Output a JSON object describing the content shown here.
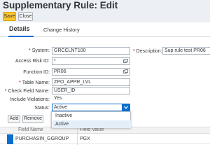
{
  "window": {
    "title": "Supplementary Rule: Edit"
  },
  "toolbar": {
    "save_label": "Save",
    "close_label": "Close"
  },
  "tabs": [
    {
      "label": "Details"
    },
    {
      "label": "Change History"
    }
  ],
  "form": {
    "system": {
      "label": "System:",
      "value": "GRCCLNT100"
    },
    "access_risk_id": {
      "label": "Access Risk ID:",
      "value": "*"
    },
    "function_id": {
      "label": "Function ID:",
      "value": "PR06"
    },
    "table_name": {
      "label": "Table Name:",
      "value": "ZPO_APPR_LVL"
    },
    "check_field_name": {
      "label": "Check Field Name:",
      "value": "USER_ID"
    },
    "include_violations": {
      "label": "Include Violations:",
      "value": "Yes"
    },
    "status": {
      "label": "Status:",
      "value": "Active"
    },
    "description": {
      "label": "Description:",
      "value": "Sup rule test PR06"
    }
  },
  "status_dropdown": {
    "options": [
      "Inactive",
      "Active"
    ],
    "selected": "Active"
  },
  "table_toolbar": {
    "add_label": "Add",
    "remove_label": "Remove"
  },
  "grid": {
    "columns": [
      "Field Name",
      "Field Value"
    ],
    "rows": [
      {
        "field_name": "PURCHASIN_GGROUP",
        "field_value": "PGX"
      }
    ]
  },
  "colors": {
    "accent": "#0a6ed1",
    "save_button": "#ffc82f",
    "required": "#bb0000"
  }
}
